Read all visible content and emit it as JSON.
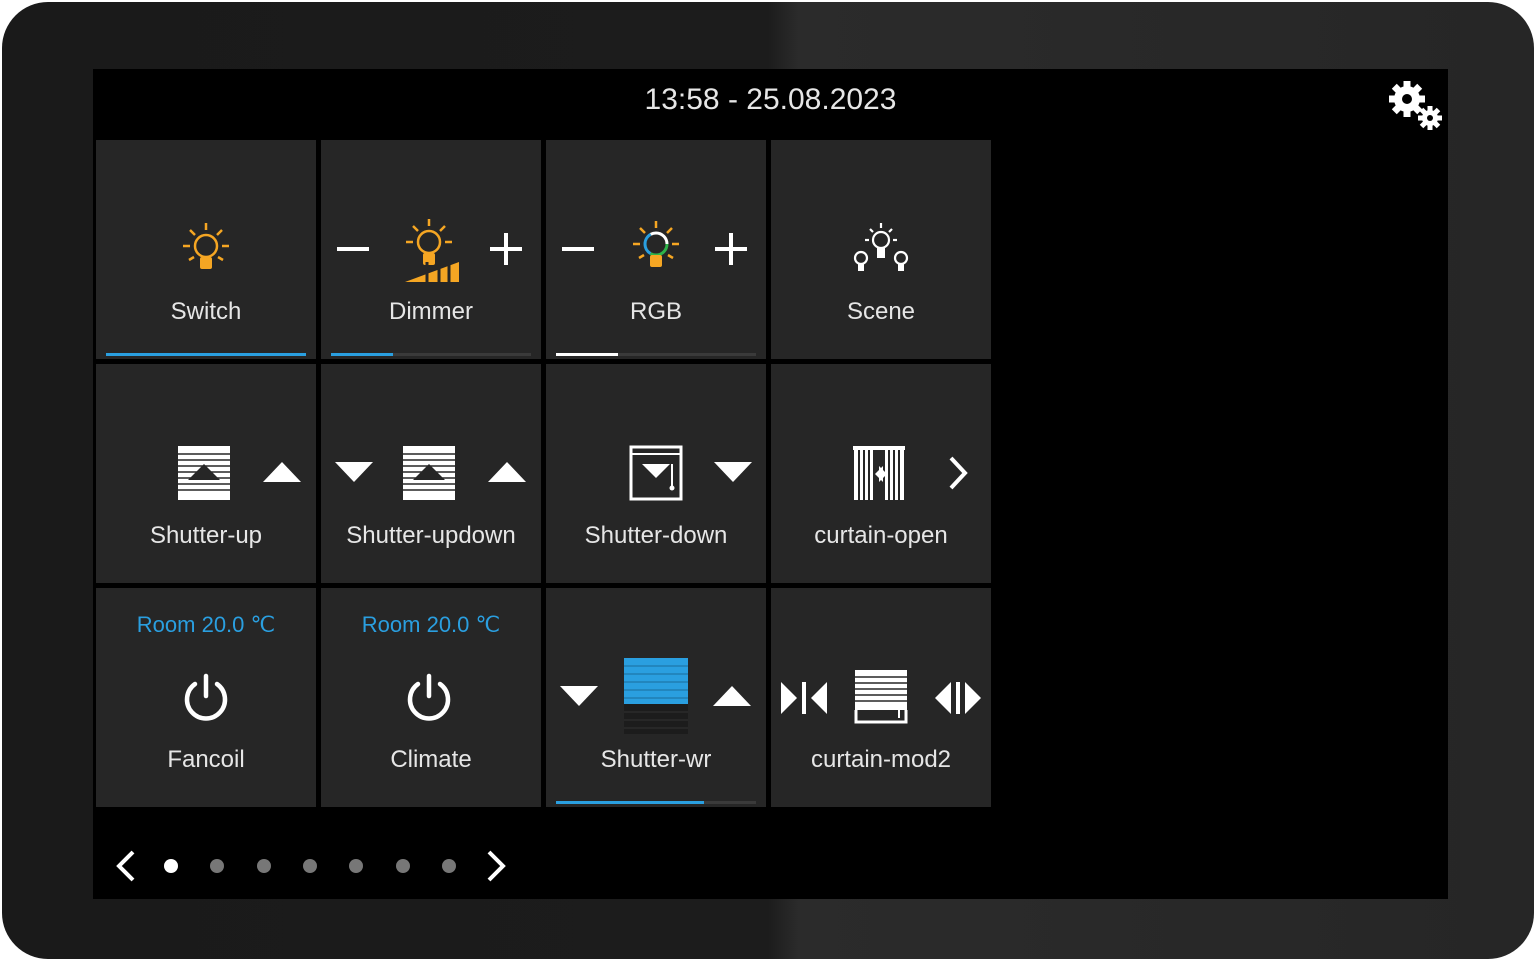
{
  "header": {
    "datetime": "13:58 - 25.08.2023"
  },
  "tiles": [
    {
      "label": "Switch",
      "icon": "bulb-icon",
      "level": 1.0
    },
    {
      "label": "Dimmer",
      "icon": "dimmer-bulb-icon",
      "level": 0.31
    },
    {
      "label": "RGB",
      "icon": "rgb-bulb-icon",
      "level": 0.31
    },
    {
      "label": "Scene",
      "icon": "scene-icon"
    },
    {
      "label": "Shutter-up",
      "icon": "shutter-icon"
    },
    {
      "label": "Shutter-updown",
      "icon": "shutter-icon"
    },
    {
      "label": "Shutter-down",
      "icon": "shutter-down-icon"
    },
    {
      "label": "curtain-open",
      "icon": "curtain-icon"
    },
    {
      "label": "Fancoil",
      "room": "Room 20.0 ℃",
      "icon": "power-icon"
    },
    {
      "label": "Climate",
      "room": "Room 20.0 ℃",
      "icon": "power-icon"
    },
    {
      "label": "Shutter-wr",
      "icon": "shutter-wr-icon",
      "level": 0.74
    },
    {
      "label": "curtain-mod2",
      "icon": "curtain-mod-icon"
    }
  ],
  "pager": {
    "pages": 7,
    "current": 1
  },
  "colors": {
    "accent": "#2a9fe0",
    "bulb": "#f5a623",
    "tile": "#262626"
  }
}
